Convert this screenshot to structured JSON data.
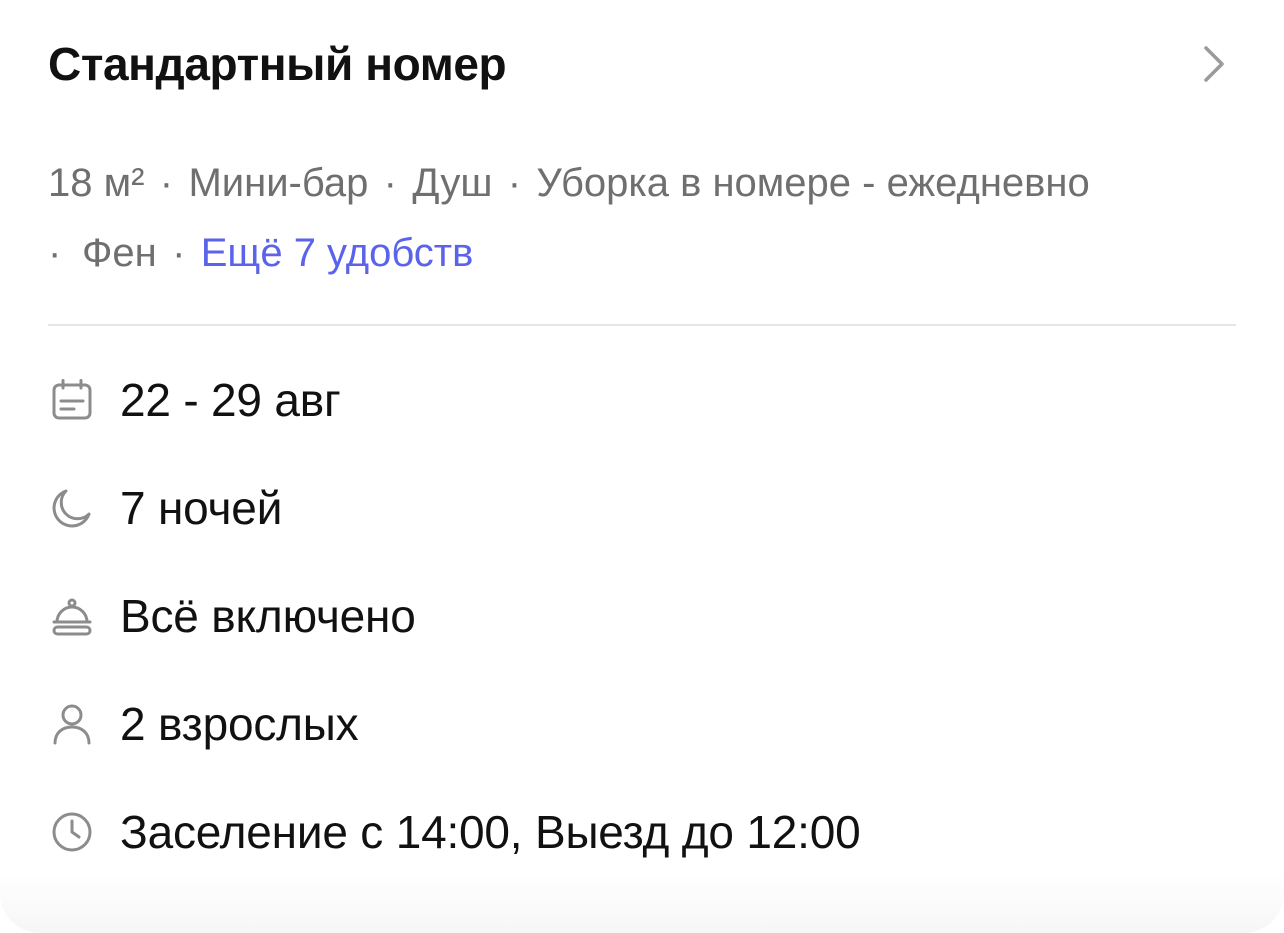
{
  "room": {
    "title": "Стандартный номер",
    "chevron_icon": "chevron-right-icon"
  },
  "amenities": {
    "separator": "·",
    "items": [
      "18 м²",
      "Мини-бар",
      "Душ",
      "Уборка в номере - ежедневно",
      "Фен"
    ],
    "more_link": "Ещё 7 удобств"
  },
  "details": [
    {
      "icon": "calendar-icon",
      "text": "22 - 29 авг"
    },
    {
      "icon": "moon-icon",
      "text": "7 ночей"
    },
    {
      "icon": "food-cloche-icon",
      "text": "Всё включено"
    },
    {
      "icon": "person-icon",
      "text": "2 взрослых"
    },
    {
      "icon": "clock-icon",
      "text": "Заселение с 14:00, Выезд до 12:00"
    }
  ],
  "colors": {
    "text_primary": "#111111",
    "text_secondary": "#6f6f6f",
    "link": "#5a63ea",
    "icon_gray": "#8c8c8c",
    "divider": "#e6e6e6"
  }
}
